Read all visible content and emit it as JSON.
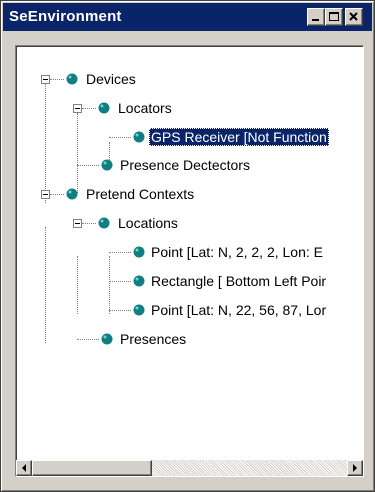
{
  "window": {
    "title": "SeEnvironment",
    "buttons": {
      "minimize": "minimize-icon",
      "maximize": "maximize-icon",
      "close": "close-icon"
    }
  },
  "tree": {
    "node_icon_color": "#0f7f7f",
    "selection_color": "#0a246a",
    "nodes": [
      {
        "label": "Devices",
        "depth": 0,
        "expanded": true
      },
      {
        "label": "Locators",
        "depth": 1,
        "expanded": true
      },
      {
        "label": "GPS Receiver [Not Function",
        "depth": 2,
        "selected": true
      },
      {
        "label": "Presence Dectectors",
        "depth": 1
      },
      {
        "label": "Pretend Contexts",
        "depth": 0,
        "expanded": true
      },
      {
        "label": "Locations",
        "depth": 1,
        "expanded": true
      },
      {
        "label": "Point [Lat: N, 2, 2, 2, Lon: E",
        "depth": 2
      },
      {
        "label": "Rectangle [ Bottom Left Poir",
        "depth": 2
      },
      {
        "label": "Point [Lat: N, 22, 56, 87, Lor",
        "depth": 2
      },
      {
        "label": "Presences",
        "depth": 1
      }
    ]
  },
  "scrollbar": {
    "left_icon": "arrow-left-icon",
    "right_icon": "arrow-right-icon",
    "position": 0
  }
}
